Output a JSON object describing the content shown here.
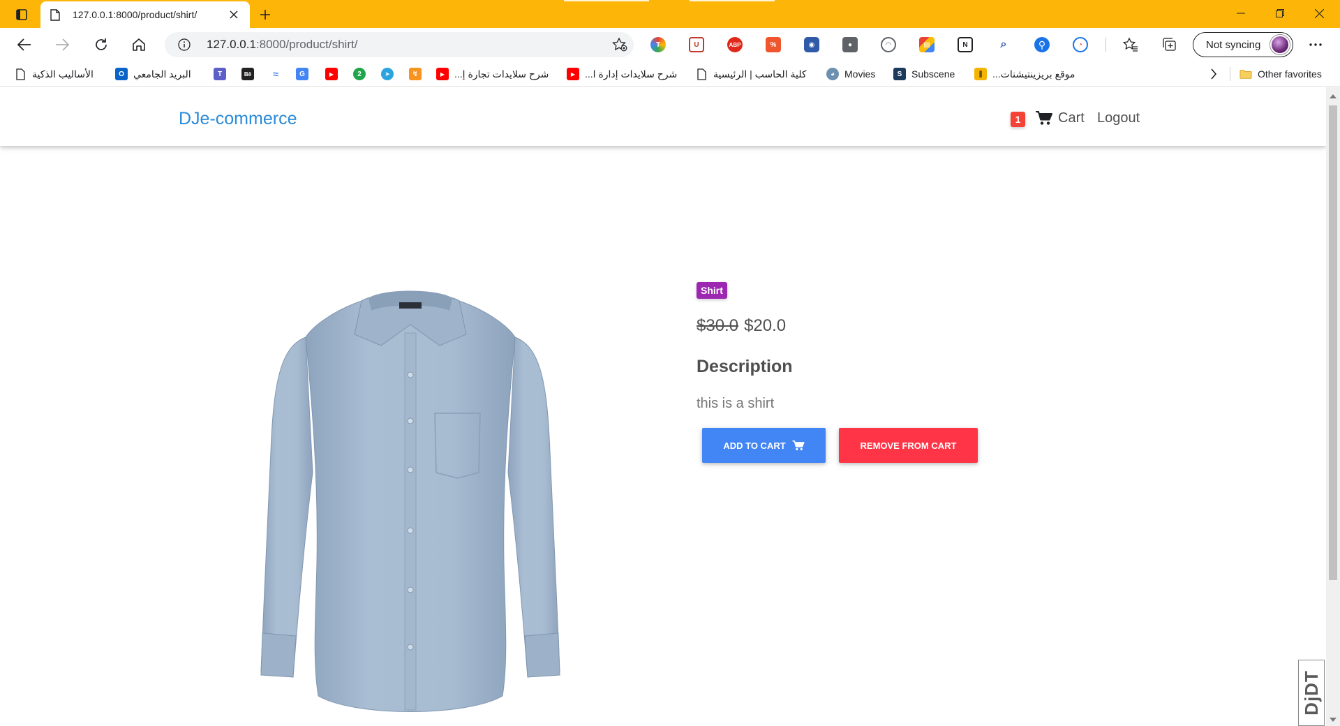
{
  "browser": {
    "tab_title": "127.0.0.1:8000/product/shirt/",
    "address": {
      "host": "127.0.0.1",
      "path": ":8000/product/shirt/"
    },
    "sync_label": "Not syncing",
    "other_favorites": "Other favorites",
    "favorites": [
      {
        "label": "الأساليب الذكية",
        "icon": "document-icon"
      },
      {
        "label": "البريد الجامعي",
        "icon": "outlook-icon"
      },
      {
        "label": "",
        "icon": "teams-icon"
      },
      {
        "label": "",
        "icon": "behance-icon"
      },
      {
        "label": "",
        "icon": "audio-wave-icon"
      },
      {
        "label": "",
        "icon": "translate-icon"
      },
      {
        "label": "",
        "icon": "youtube-icon"
      },
      {
        "label": "",
        "icon": "green-circle-icon"
      },
      {
        "label": "",
        "icon": "telegram-icon"
      },
      {
        "label": "",
        "icon": "orange-app-icon"
      },
      {
        "label": "شرح سلايدات تجارة إ...",
        "icon": "youtube-icon"
      },
      {
        "label": "شرح سلايدات إدارة ا...",
        "icon": "youtube-icon"
      },
      {
        "label": "كلية الحاسب | الرئيسية",
        "icon": "document-icon"
      },
      {
        "label": "Movies",
        "icon": "movies-icon"
      },
      {
        "label": "Subscene",
        "icon": "subscene-icon"
      },
      {
        "label": "موقع بريزينتيشنات...",
        "icon": "slides-icon"
      }
    ],
    "colors": {
      "tabstrip": "#FDB608"
    }
  },
  "page": {
    "brand": "DJe-commerce",
    "cart_count": "1",
    "cart_label": "Cart",
    "logout_label": "Logout",
    "product": {
      "category": "Shirt",
      "old_price": "$30.0",
      "price": "$20.0",
      "description_title": "Description",
      "description": "this is a shirt",
      "add_to_cart": "ADD TO CART",
      "remove_from_cart": "REMOVE FROM CART"
    },
    "debug_toolbar": "DjDT",
    "colors": {
      "brand": "#2a8ad8",
      "add_button": "#4285f4",
      "remove_button": "#ff3547",
      "category_badge": "#9c27b0",
      "cart_badge": "#f44336"
    }
  }
}
